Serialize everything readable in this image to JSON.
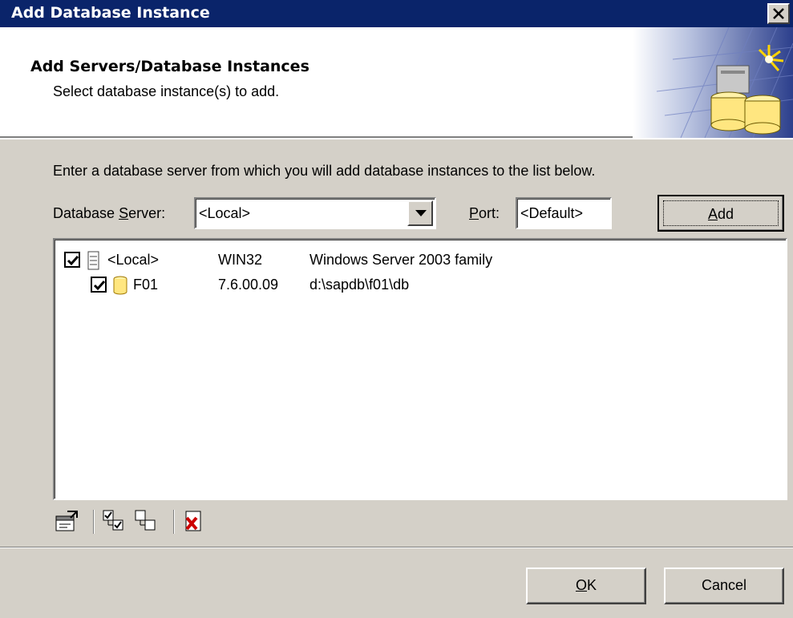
{
  "window": {
    "title": "Add Database Instance"
  },
  "header": {
    "title": "Add Servers/Database Instances",
    "subtitle": "Select database instance(s) to add."
  },
  "form": {
    "prompt": "Enter a database server from which you will add database instances to the list below.",
    "server_label_pre": "Database ",
    "server_label_ul": "S",
    "server_label_post": "erver:",
    "server_value": "<Local>",
    "port_label_ul": "P",
    "port_label_post": "ort:",
    "port_value": "<Default>",
    "add_ul": "A",
    "add_post": "dd"
  },
  "list": {
    "rows": [
      {
        "checked": true,
        "icon": "server-icon",
        "name": "<Local>",
        "col2": "WIN32",
        "col3": "Windows Server 2003 family"
      },
      {
        "checked": true,
        "icon": "database-icon",
        "name": "F01",
        "col2": "7.6.00.09",
        "col3": "d:\\sapdb\\f01\\db"
      }
    ]
  },
  "toolbar": {
    "icons": [
      "properties-icon",
      "select-all-icon",
      "deselect-all-icon",
      "delete-icon"
    ]
  },
  "footer": {
    "ok_ul": "O",
    "ok_post": "K",
    "cancel_label": "Cancel"
  },
  "colors": {
    "titlebar": "#0a246a",
    "dialog_face": "#d4d0c8",
    "delete_red": "#cc0000",
    "db_yellow": "#ffe680"
  }
}
